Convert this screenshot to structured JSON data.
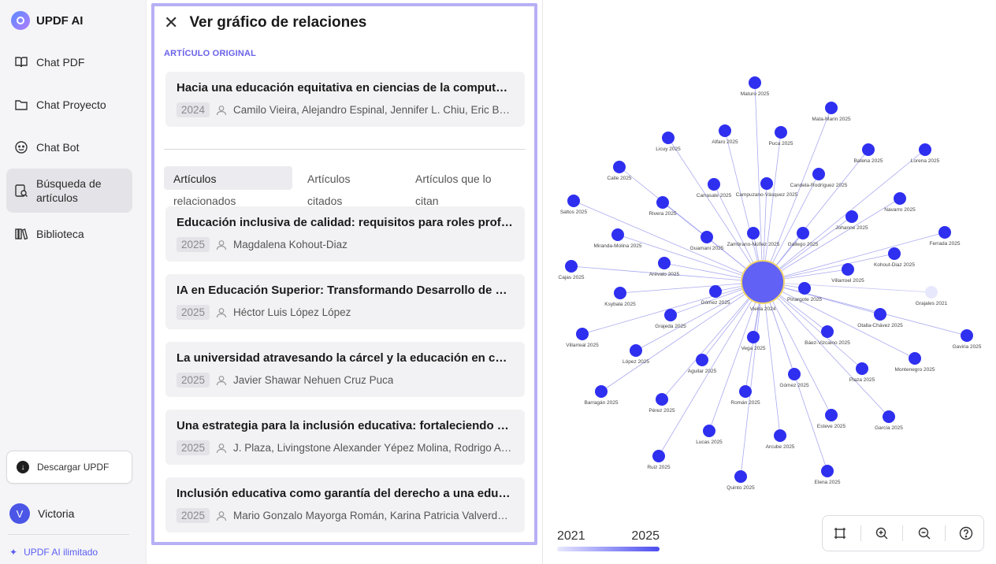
{
  "app": {
    "name": "UPDF AI"
  },
  "sidebar": {
    "items": [
      {
        "label": "Chat PDF",
        "icon": "book-open-icon"
      },
      {
        "label": "Chat Proyecto",
        "icon": "folder-icon"
      },
      {
        "label": "Chat Bot",
        "icon": "bot-icon"
      },
      {
        "label": "Búsqueda de artículos",
        "icon": "search-document-icon",
        "active": true
      },
      {
        "label": "Biblioteca",
        "icon": "library-icon"
      }
    ],
    "download_label": "Descargar UPDF",
    "user": {
      "initial": "V",
      "name": "Victoria"
    },
    "upgrade_label": "UPDF AI ilimitado"
  },
  "panel": {
    "title": "Ver gráfico de relaciones",
    "section_label": "ARTÍCULO ORIGINAL",
    "original": {
      "title": "Hacia una educación equitativa en ciencias de la computación",
      "year": "2024",
      "authors": "Camilo Vieira, Alejandro Espinal, Jennifer L. Chiu, Eric Baumgartner"
    },
    "tabs": [
      {
        "line1": "Artículos",
        "line2": "relacionados",
        "active": true
      },
      {
        "line1": "Artículos",
        "line2": "citados"
      },
      {
        "line1": "Artículos que lo",
        "line2": "citan"
      }
    ],
    "articles": [
      {
        "title": "Educación inclusiva de calidad: requisitos para roles profesionales",
        "year": "2025",
        "authors": "Magdalena Kohout-Diaz"
      },
      {
        "title": "IA en Educación Superior: Transformando Desarrollo de Competencias",
        "year": "2025",
        "authors": "Héctor Luis López López"
      },
      {
        "title": "La universidad atravesando la cárcel y la educación en contextos de encierro",
        "year": "2025",
        "authors": "Javier Shawar Nehuen Cruz Puca"
      },
      {
        "title": "Una estrategia para la inclusión educativa: fortaleciendo capacidades docentes",
        "year": "2025",
        "authors": "J. Plaza, Livingstone Alexander Yépez Molina, Rodrigo Arévalo"
      },
      {
        "title": "Inclusión educativa como garantía del derecho a una educación de calidad",
        "year": "2025",
        "authors": "Mario Gonzalo Mayorga Román, Karina Patricia Valverde Alulema"
      }
    ]
  },
  "graph": {
    "legend": {
      "min": "2021",
      "max": "2025"
    },
    "colors": {
      "node": "#2f2ff0",
      "center": "#6161f5",
      "center_ring": "#f0d36a",
      "faint": "#e8e8fc",
      "edge": "#a9a9f0"
    },
    "center": {
      "label": "Vieira 2024"
    },
    "nodes": [
      "Maturo 2025",
      "Mata-Marin 2025",
      "Licuy 2025",
      "Alfaro 2025",
      "Puca 2025",
      "Batenа 2025",
      "Lorena 2025",
      "Calle 2025",
      "Carrasale 2025",
      "Campuzano-Vásquez 2025",
      "Candela-Rodríguez 2025",
      "Saltos 2025",
      "Rivera 2025",
      "Navarro 2025",
      "Johanne 2025",
      "Ferrada 2025",
      "Miranda-Molina 2025",
      "Guamani 2025",
      "Zambrano-Núñez 2025",
      "Gallego 2025",
      "Kohout-Diaz 2025",
      "Cajas 2025",
      "Arévalo 2025",
      "Villarroel 2025",
      "Ksybala 2025",
      "Gómez 2025",
      "Pinargote 2025",
      "Grajales 2021",
      "Grajeda 2025",
      "Otalla-Chávez 2025",
      "Villarreal 2025",
      "Báez-Vizcaino 2025",
      "Gaviria 2025",
      "López 2025",
      "Vega 2025",
      "Montenegro 2025",
      "Aguilar 2025",
      "Plaza 2025",
      "Gómez 2025",
      "Barragán 2025",
      "Román 2025",
      "Pérez 2025",
      "Esteve 2025",
      "García 2025",
      "Lucas 2025",
      "Arcube 2025",
      "Ruiz 2025",
      "Quinto 2025",
      "Elena 2025"
    ]
  },
  "toolbar": {
    "tools": [
      {
        "name": "fit-view-button",
        "icon": "frame-icon"
      },
      {
        "name": "zoom-in-button",
        "icon": "zoom-in-icon"
      },
      {
        "name": "zoom-out-button",
        "icon": "zoom-out-icon"
      },
      {
        "name": "help-button",
        "icon": "help-icon"
      }
    ]
  }
}
